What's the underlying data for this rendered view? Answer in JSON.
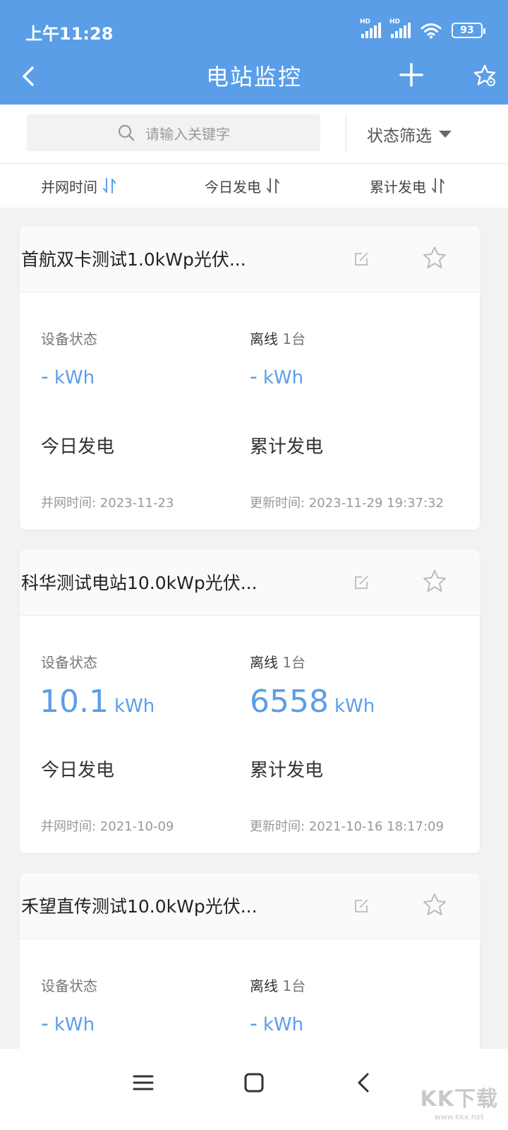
{
  "status_bar": {
    "time": "上午11:28",
    "hd1": "HD",
    "hd2": "HD",
    "battery": "93"
  },
  "header": {
    "title": "电站监控"
  },
  "search": {
    "placeholder": "请输入关键字"
  },
  "filter": {
    "label": "状态筛选"
  },
  "sort": {
    "items": [
      {
        "label": "并网时间"
      },
      {
        "label": "今日发电"
      },
      {
        "label": "累计发电"
      }
    ]
  },
  "cards": [
    {
      "title": "首航双卡测试1.0kWp光伏...",
      "device_status_label": "设备状态",
      "offline_label": "离线",
      "offline_count": "1台",
      "today_value": "-",
      "today_unit": "kWh",
      "total_value": "-",
      "total_unit": "kWh",
      "today_label": "今日发电",
      "total_label": "累计发电",
      "grid_time": "并网时间: 2023-11-23",
      "update_time": "更新时间: 2023-11-29 19:37:32"
    },
    {
      "title": "科华测试电站10.0kWp光伏...",
      "device_status_label": "设备状态",
      "offline_label": "离线",
      "offline_count": "1台",
      "today_value": "10.1",
      "today_unit": "kWh",
      "total_value": "6558",
      "total_unit": "kWh",
      "today_label": "今日发电",
      "total_label": "累计发电",
      "grid_time": "并网时间: 2021-10-09",
      "update_time": "更新时间: 2021-10-16 18:17:09"
    },
    {
      "title": "禾望直传测试10.0kWp光伏...",
      "device_status_label": "设备状态",
      "offline_label": "离线",
      "offline_count": "1台",
      "today_value": "-",
      "today_unit": "kWh",
      "total_value": "-",
      "total_unit": "kWh"
    }
  ],
  "watermark": {
    "logo": "KK下载",
    "url": "www.kkx.net"
  },
  "colors": {
    "primary": "#5a9ee8",
    "value": "#5a9ee8",
    "background": "#f2f2f2"
  }
}
